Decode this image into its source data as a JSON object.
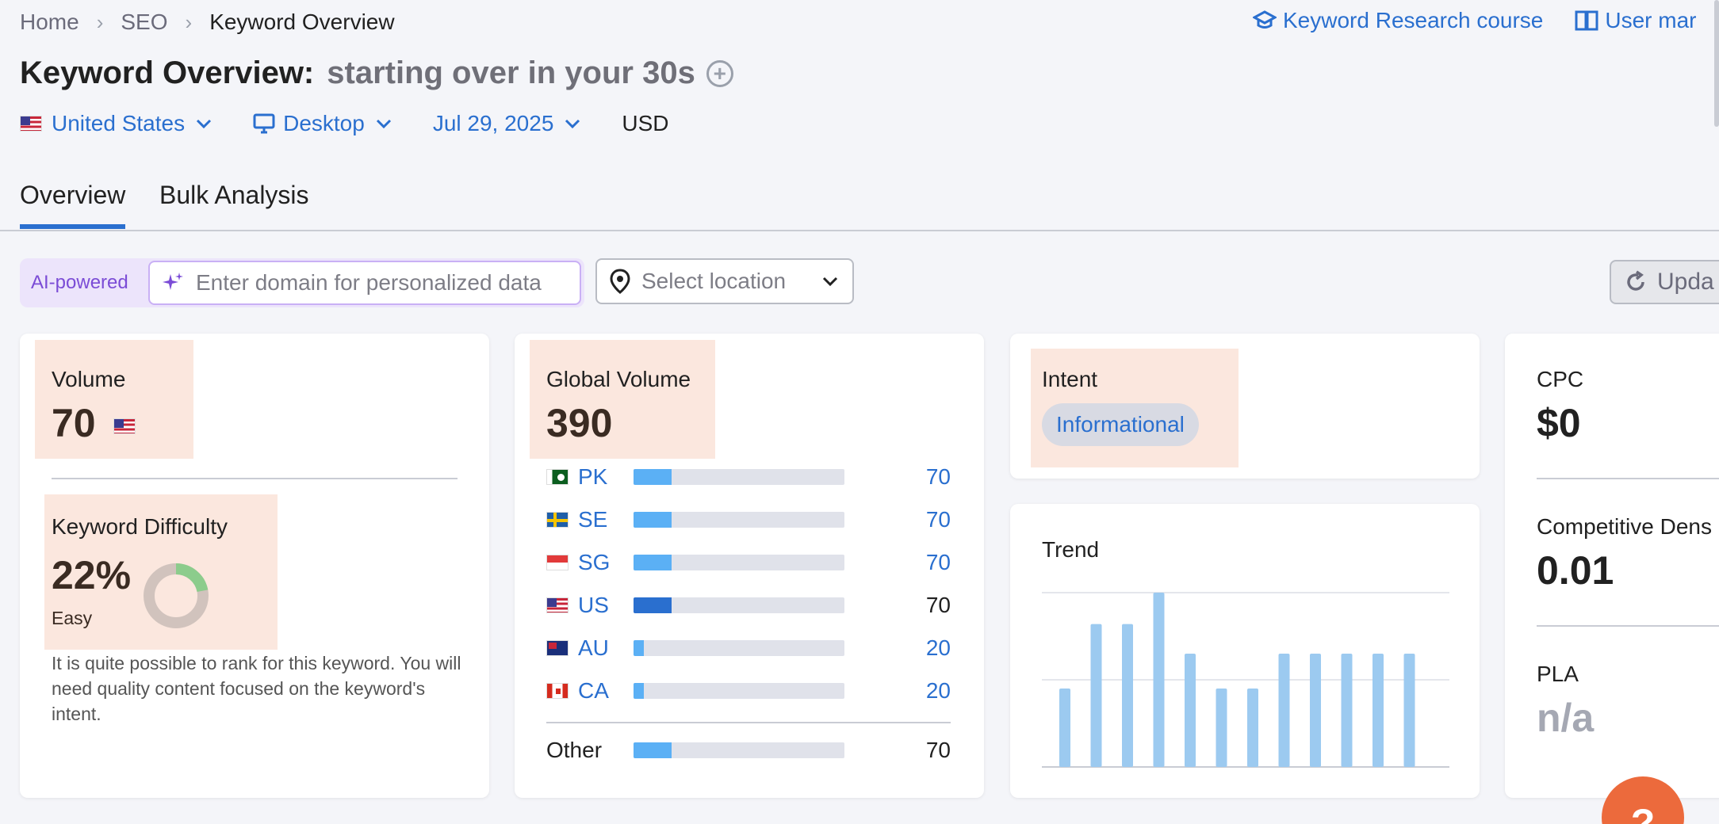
{
  "breadcrumb": [
    "Home",
    "SEO",
    "Keyword Overview"
  ],
  "top_links": {
    "course": "Keyword Research course",
    "manual": "User mar"
  },
  "title": {
    "label": "Keyword Overview:",
    "keyword": "starting over in your 30s"
  },
  "filters": {
    "country": "United States",
    "device": "Desktop",
    "date": "Jul 29, 2025",
    "currency": "USD"
  },
  "tabs": [
    "Overview",
    "Bulk Analysis"
  ],
  "ai_bar": {
    "label": "AI-powered",
    "placeholder": "Enter domain for personalized data"
  },
  "location": {
    "placeholder": "Select location"
  },
  "update_button": "Upda",
  "volume": {
    "label": "Volume",
    "value": "70"
  },
  "keyword_difficulty": {
    "label": "Keyword Difficulty",
    "value": "22%",
    "level": "Easy",
    "percent": 22,
    "description": "It is quite possible to rank for this keyword. You will need quality content focused on the keyword's intent."
  },
  "global_volume": {
    "label": "Global Volume",
    "value": "390",
    "countries": [
      {
        "code": "PK",
        "value": "70",
        "share": 0.18,
        "highlight": false
      },
      {
        "code": "SE",
        "value": "70",
        "share": 0.18,
        "highlight": false
      },
      {
        "code": "SG",
        "value": "70",
        "share": 0.18,
        "highlight": false
      },
      {
        "code": "US",
        "value": "70",
        "share": 0.18,
        "highlight": true
      },
      {
        "code": "AU",
        "value": "20",
        "share": 0.05,
        "highlight": false
      },
      {
        "code": "CA",
        "value": "20",
        "share": 0.05,
        "highlight": false
      }
    ],
    "other": {
      "label": "Other",
      "value": "70",
      "share": 0.18
    }
  },
  "intent": {
    "label": "Intent",
    "value": "Informational"
  },
  "trend": {
    "label": "Trend",
    "values": [
      0.45,
      0.82,
      0.82,
      1.0,
      0.65,
      0.45,
      0.45,
      0.65,
      0.65,
      0.65,
      0.65,
      0.65
    ]
  },
  "cpc": {
    "label": "CPC",
    "value": "$0"
  },
  "competitive_density": {
    "label": "Competitive Dens",
    "value": "0.01"
  },
  "pla": {
    "label": "PLA",
    "value": "n/a"
  },
  "help": "?",
  "colors": {
    "accent": "#2a6fcf",
    "highlight": "#fbe7de",
    "bar": "#5bb0f5",
    "bar_dark": "#2a6fcf",
    "trend_bar": "#9ccaf0",
    "kd_green": "#8ccc8c",
    "kd_track": "#d1c3bd",
    "help": "#ec6a3c"
  }
}
